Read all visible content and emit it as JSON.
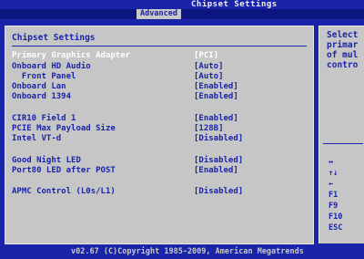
{
  "app": {
    "title": "Chipset Settings"
  },
  "tabs": [
    {
      "label": "Advanced",
      "active": true
    }
  ],
  "main": {
    "section_title": "Chipset Settings",
    "settings": [
      {
        "label": "Primary Graphics Adapter",
        "value": "[PCI]",
        "selected": true
      },
      {
        "label": "Onboard HD Audio",
        "value": "[Auto]"
      },
      {
        "label": "  Front Panel",
        "value": "[Auto]"
      },
      {
        "label": "Onboard Lan",
        "value": "[Enabled]"
      },
      {
        "label": "Onboard 1394",
        "value": "[Enabled]"
      },
      {
        "label": "CIR10 Field 1",
        "value": "[Enabled]"
      },
      {
        "label": "PCIE Max Payload Size",
        "value": "[128B]"
      },
      {
        "label": "Intel VT-d",
        "value": "[Disabled]"
      },
      {
        "label": "Good Night LED",
        "value": "[Disabled]"
      },
      {
        "label": "Port80 LED after POST",
        "value": "[Enabled]"
      },
      {
        "label": "APMC Control (L0s/L1)",
        "value": "[Disabled]"
      }
    ]
  },
  "help": {
    "text": "Select\nprimar\nof mul\ncontro",
    "keys": [
      {
        "label": "↔",
        "icon": "left-right-arrow-icon"
      },
      {
        "label": "↑↓",
        "icon": "up-down-arrow-icon"
      },
      {
        "label": "←",
        "icon": "enter-arrow-icon"
      },
      {
        "label": "F1"
      },
      {
        "label": "F9"
      },
      {
        "label": "F10"
      },
      {
        "label": "ESC"
      }
    ]
  },
  "footer": {
    "text": "v02.67 (C)Copyright 1985-2009, American Megatrends"
  },
  "colors": {
    "background": "#1a24a8",
    "panel": "#c6c6c6",
    "text": "#1a24a8",
    "selected": "#ffffff"
  }
}
